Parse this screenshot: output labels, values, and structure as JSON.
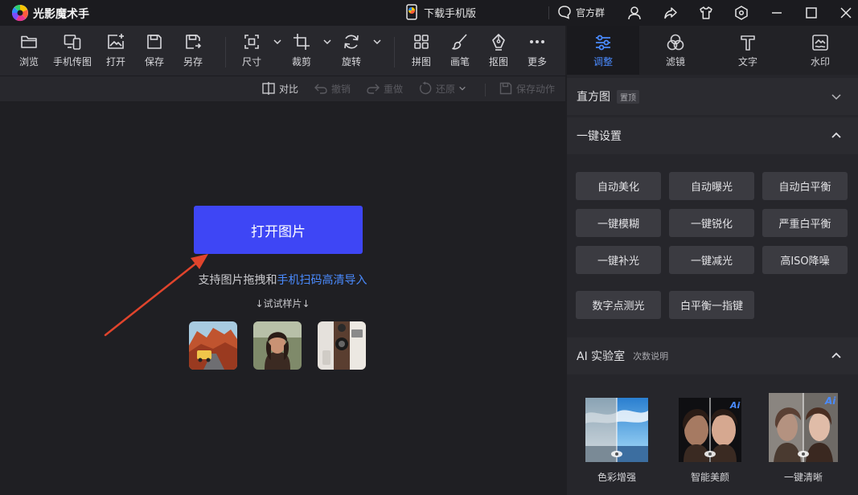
{
  "app": {
    "title": "光影魔术手"
  },
  "titlebar": {
    "download_label": "下载手机版",
    "official_group_label": "官方群"
  },
  "toolbar": {
    "browse": "浏览",
    "phone_transfer": "手机传图",
    "open": "打开",
    "save": "保存",
    "save_as": "另存",
    "size": "尺寸",
    "crop": "裁剪",
    "rotate": "旋转",
    "collage": "拼图",
    "brush": "画笔",
    "cutout": "抠图",
    "more": "更多"
  },
  "subbar": {
    "compare": "对比",
    "undo": "撤销",
    "redo": "重做",
    "restore": "还原",
    "save_action": "保存动作"
  },
  "canvas": {
    "open_button": "打开图片",
    "hint_prefix": "支持图片拖拽和",
    "hint_link": "手机扫码高清导入",
    "try_samples": "↓试试样片↓"
  },
  "right_tabs": [
    {
      "label": "调整",
      "active": true
    },
    {
      "label": "滤镜",
      "active": false
    },
    {
      "label": "文字",
      "active": false
    },
    {
      "label": "水印",
      "active": false
    }
  ],
  "histogram": {
    "title": "直方图",
    "badge": "置顶"
  },
  "one_click": {
    "title": "一键设置",
    "buttons": [
      "自动美化",
      "自动曝光",
      "自动白平衡",
      "一键模糊",
      "一键锐化",
      "严重白平衡",
      "一键补光",
      "一键减光",
      "高ISO降噪",
      "数字点测光",
      "白平衡一指键"
    ]
  },
  "ai_lab": {
    "title": "AI 实验室",
    "sub": "次数说明",
    "items": [
      "色彩增强",
      "智能美颜",
      "一键清晰"
    ]
  },
  "colors": {
    "accent": "#3e46f5",
    "link": "#4a8bff",
    "arrow": "#e0442c"
  }
}
